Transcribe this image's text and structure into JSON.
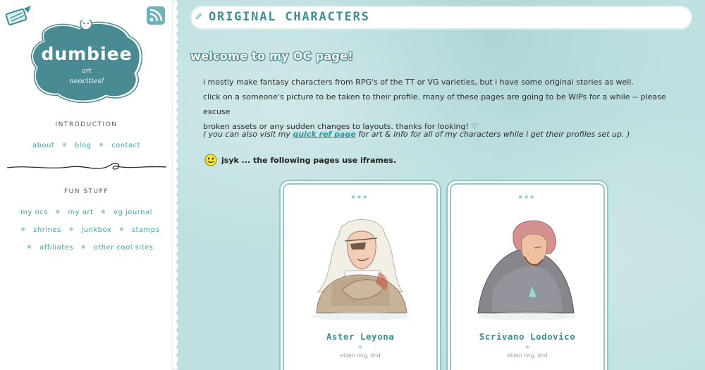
{
  "sidebar": {
    "logo": {
      "title": "dumbiee",
      "sub1": "art",
      "sub2": "neocities!"
    },
    "sections": [
      {
        "heading": "INTRODUCTION",
        "links": [
          "about",
          "blog",
          "contact"
        ]
      },
      {
        "heading": "FUN STUFF",
        "rows": [
          [
            "my ocs",
            "my art",
            "vg journal"
          ],
          [
            "shrines",
            "junkbox",
            "stamps"
          ],
          [
            "affiliates",
            "other cool sites"
          ]
        ]
      }
    ],
    "icons": {
      "top_left": "paper-airplane-icon",
      "top_right": "rss-feed-icon"
    }
  },
  "header": {
    "title": "ORIGINAL CHARACTERS",
    "icon": "pencil-icon"
  },
  "content": {
    "welcome": "welcome to my OC page!",
    "para1_line1": "i mostly make fantasy characters from RPG's of the TT or VG varieties, but i have some original stories as well.",
    "para1_line2": "click on a someone's picture to be taken to their profile. many of these pages are going to be WIPs for a while -- please excuse",
    "para1_line3": "broken assets or any sudden changes to layouts. thanks for looking! ♡",
    "para2_before": "( you can also visit my ",
    "para2_link": "quick ref page",
    "para2_after": " for art & info for all of my characters while i get their profiles set up. )",
    "jsyk": "jsyk ... the following pages use iframes.",
    "jsyk_icon": "smiley-icon"
  },
  "characters": [
    {
      "name": "Aster Leyona",
      "tags": "elden ring, dnd"
    },
    {
      "name": "Scrivano Lodovico",
      "tags": "elden ring, dnd"
    }
  ],
  "colors": {
    "accent": "#3ea3aa",
    "background": "#bfe0e0",
    "sidebar": "#ffffff",
    "logo_blob": "#4a8a92"
  }
}
